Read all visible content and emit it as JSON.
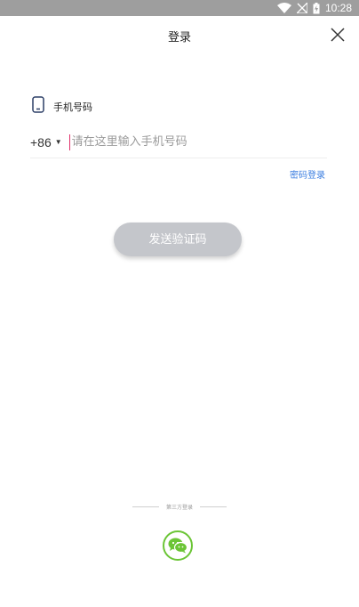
{
  "status_bar": {
    "time": "10:28",
    "wifi_icon": "wifi-icon",
    "signal_icon": "signal-off-icon",
    "battery_icon": "battery-charging-icon"
  },
  "header": {
    "title": "登录",
    "close_icon": "close-icon"
  },
  "phone": {
    "label": "手机号码",
    "icon": "phone-icon",
    "country_code": "+86",
    "caret": "▼",
    "placeholder": "请在这里输入手机号码",
    "value": ""
  },
  "links": {
    "password_login": "密码登录"
  },
  "actions": {
    "send_code": "发送验证码"
  },
  "third_party": {
    "label": "第三方登录",
    "wechat_icon": "wechat-icon"
  },
  "colors": {
    "accent_link": "#3a7de0",
    "button_disabled": "#c4c6cb",
    "wechat_green": "#6bc536",
    "cursor": "#e0306a"
  }
}
